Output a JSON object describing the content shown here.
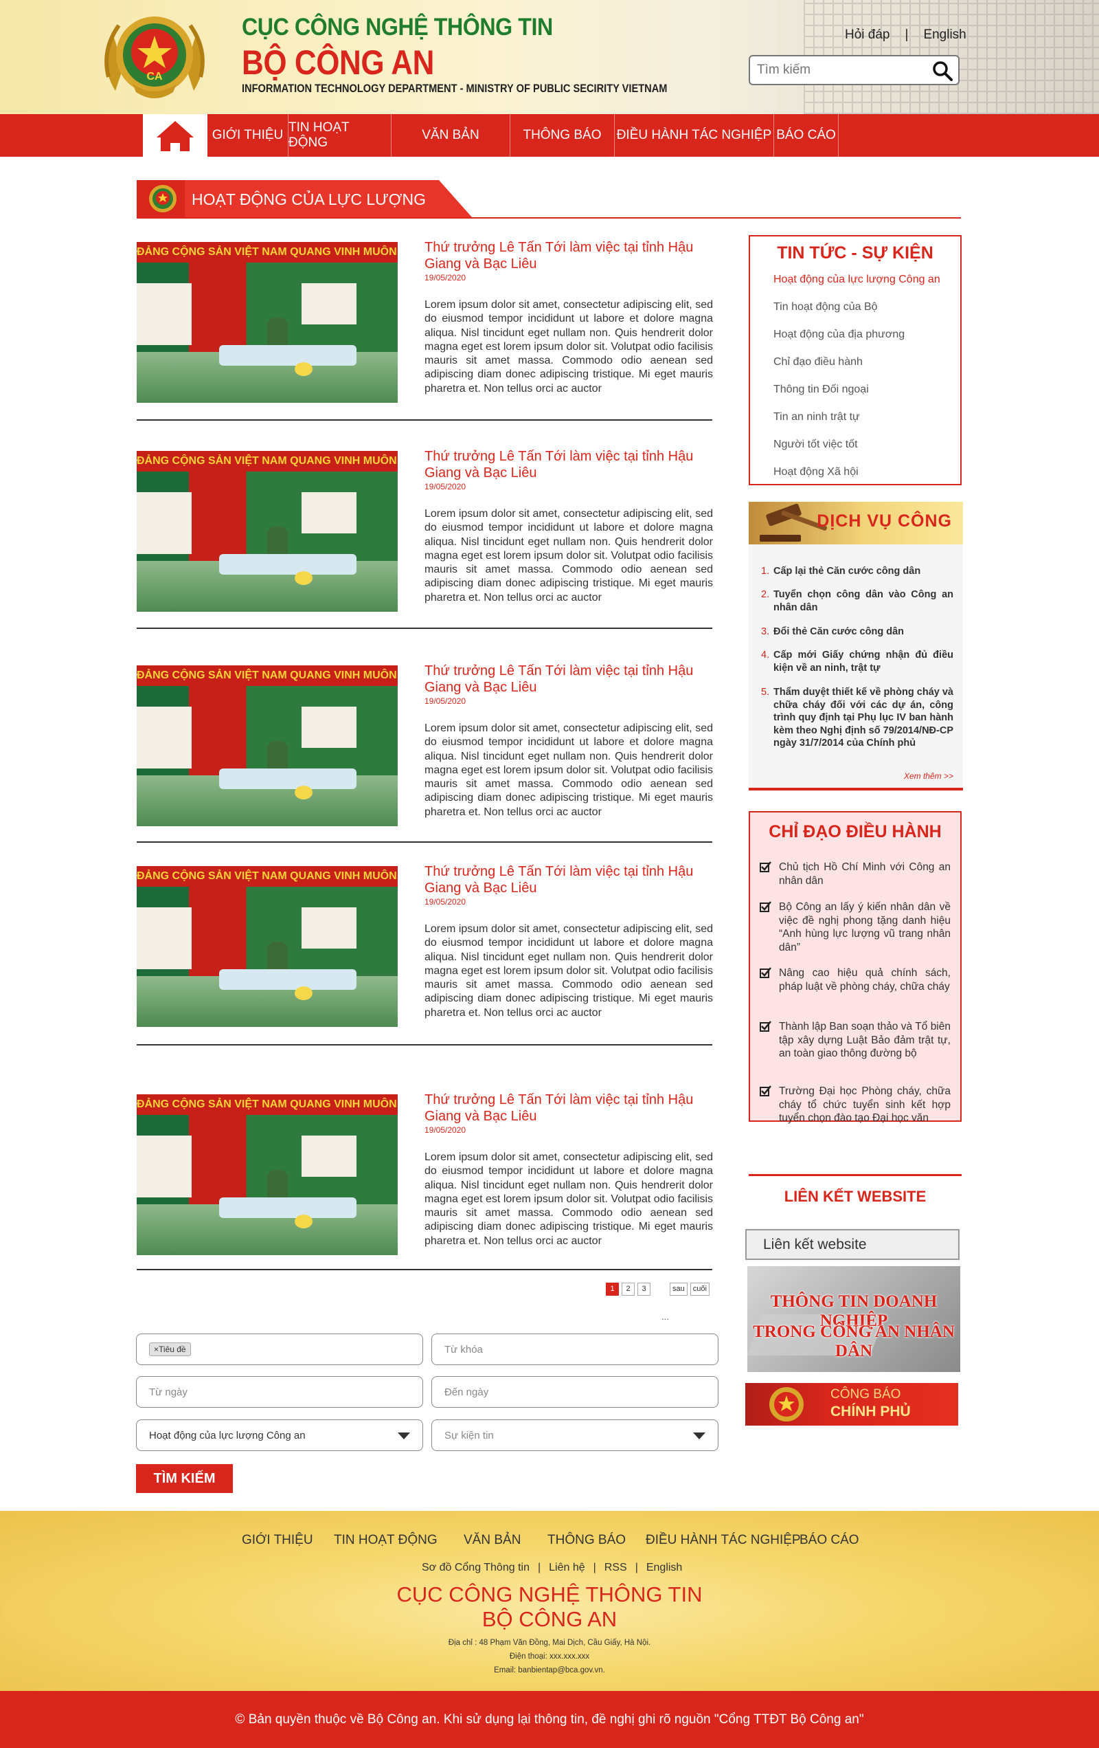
{
  "header": {
    "title_line1": "CỤC CÔNG NGHỆ THÔNG TIN",
    "title_line2": "BỘ CÔNG AN",
    "title_line3": "INFORMATION TECHNOLOGY DEPARTMENT - MINISTRY OF PUBLIC SECIRITY VIETNAM",
    "faq": "Hỏi đáp",
    "english": "English",
    "search_placeholder": "Tìm kiếm"
  },
  "nav": [
    "GIỚI THIỆU",
    "TIN HOẠT ĐỘNG",
    "VĂN BẢN",
    "THÔNG BÁO",
    "ĐIỀU HÀNH TÁC NGHIỆP",
    "BÁO CÁO"
  ],
  "section_title": "HOẠT ĐỘNG CỦA LỰC LƯỢNG",
  "image_banner": "ĐẢNG CỘNG SẢN VIỆT NAM QUANG VINH MUÔN NĂM",
  "articles": [
    {
      "title": "Thứ trưởng Lê Tấn Tới làm việc tại tỉnh Hậu Giang và Bạc Liêu",
      "date": "19/05/2020",
      "body": "Lorem ipsum dolor sit amet, consectetur adipiscing elit, sed do eiusmod tempor incididunt ut labore et dolore magna aliqua. Nisl tincidunt eget nullam non. Quis hendrerit dolor magna eget est lorem ipsum dolor sit. Volutpat odio facilisis mauris sit amet massa. Commodo odio aenean sed adipiscing diam donec adipiscing tristique. Mi eget mauris pharetra et. Non tellus orci ac auctor"
    },
    {
      "title": "Thứ trưởng Lê Tấn Tới làm việc tại tỉnh Hậu Giang và Bạc Liêu",
      "date": "19/05/2020",
      "body": "Lorem ipsum dolor sit amet, consectetur adipiscing elit, sed do eiusmod tempor incididunt ut labore et dolore magna aliqua. Nisl tincidunt eget nullam non. Quis hendrerit dolor magna eget est lorem ipsum dolor sit. Volutpat odio facilisis mauris sit amet massa. Commodo odio aenean sed adipiscing diam donec adipiscing tristique. Mi eget mauris pharetra et. Non tellus orci ac auctor"
    },
    {
      "title": "Thứ trưởng Lê Tấn Tới làm việc tại tỉnh Hậu Giang và Bạc Liêu",
      "date": "19/05/2020",
      "body": "Lorem ipsum dolor sit amet, consectetur adipiscing elit, sed do eiusmod tempor incididunt ut labore et dolore magna aliqua. Nisl tincidunt eget nullam non. Quis hendrerit dolor magna eget est lorem ipsum dolor sit. Volutpat odio facilisis mauris sit amet massa. Commodo odio aenean sed adipiscing diam donec adipiscing tristique. Mi eget mauris pharetra et. Non tellus orci ac auctor"
    },
    {
      "title": "Thứ trưởng Lê Tấn Tới làm việc tại tỉnh Hậu Giang và Bạc Liêu",
      "date": "19/05/2020",
      "body": "Lorem ipsum dolor sit amet, consectetur adipiscing elit, sed do eiusmod tempor incididunt ut labore et dolore magna aliqua. Nisl tincidunt eget nullam non. Quis hendrerit dolor magna eget est lorem ipsum dolor sit. Volutpat odio facilisis mauris sit amet massa. Commodo odio aenean sed adipiscing diam donec adipiscing tristique. Mi eget mauris pharetra et. Non tellus orci ac auctor"
    },
    {
      "title": "Thứ trưởng Lê Tấn Tới làm việc tại tỉnh Hậu Giang và Bạc Liêu",
      "date": "19/05/2020",
      "body": "Lorem ipsum dolor sit amet, consectetur adipiscing elit, sed do eiusmod tempor incididunt ut labore et dolore magna aliqua. Nisl tincidunt eget nullam non. Quis hendrerit dolor magna eget est lorem ipsum dolor sit. Volutpat odio facilisis mauris sit amet massa. Commodo odio aenean sed adipiscing diam donec adipiscing tristique. Mi eget mauris pharetra et. Non tellus orci ac auctor"
    }
  ],
  "pagination": {
    "pages": [
      "1",
      "2",
      "3"
    ],
    "active": "1",
    "next": "sau",
    "last": "cuối",
    "ellipsis": "..."
  },
  "search_form": {
    "tag": "Tiêu đề",
    "keyword_placeholder": "Từ khóa",
    "from_date_placeholder": "Từ ngày",
    "to_date_placeholder": "Đến ngày",
    "category_value": "Hoạt động của lực lượng Công an",
    "event_value": "Sự kiện tin",
    "button": "TÌM KIẾM"
  },
  "news_box": {
    "title": "TIN TỨC - SỰ KIỆN",
    "items": [
      "Hoạt động của lực lượng Công an",
      "Tin hoạt động của Bộ",
      "Hoạt động của địa phương",
      "Chỉ đạo điều hành",
      "Thông tin Đối ngoại",
      "Tin an ninh trật tự",
      "Người tốt việc tốt",
      "Hoạt động Xã hội"
    ]
  },
  "public_service": {
    "title": "DỊCH VỤ CÔNG",
    "items": [
      {
        "num": "1.",
        "text": "Cấp lại thẻ Căn cước công dân"
      },
      {
        "num": "2.",
        "text": "Tuyển chọn công dân vào Công an nhân dân"
      },
      {
        "num": "3.",
        "text": "Đổi thẻ Căn cước công dân"
      },
      {
        "num": "4.",
        "text": "Cấp mới Giấy chứng nhận đủ điều kiện về an ninh, trật tự"
      },
      {
        "num": "5.",
        "text": "Thẩm duyệt thiết kế về phòng cháy và chữa cháy đối với các dự án, công trình quy định tại Phụ lục IV ban hành kèm theo Nghị định số 79/2014/NĐ-CP ngày 31/7/2014 của Chính phủ"
      }
    ],
    "more": "Xem thêm >>"
  },
  "direction": {
    "title": "CHỈ ĐẠO ĐIỀU HÀNH",
    "items": [
      "Chủ tịch Hồ Chí Minh với Công an nhân dân",
      "Bộ Công an lấy ý kiến nhân dân về việc đề nghị phong tặng danh hiệu “Anh hùng lực lượng vũ trang nhân dân”",
      "Nâng cao hiệu quả chính sách, pháp luật về phòng cháy, chữa cháy",
      "Thành lập Ban soạn thảo và Tổ biên tập xây dựng Luật Bảo đảm trật tự, an toàn giao thông đường bộ",
      "Trường Đại học Phòng cháy, chữa cháy tổ chức tuyển sinh kết hợp tuyển chọn đào tạo Đại học văn"
    ]
  },
  "links": {
    "title": "LIÊN KẾT WEBSITE",
    "select_value": "Liên kết website",
    "banner1_line1": "THÔNG TIN DOANH NGHIỆP",
    "banner1_line2": "TRONG CÔNG AN NHÂN DÂN",
    "banner2_line1": "CÔNG BÁO",
    "banner2_line2": "CHÍNH PHỦ"
  },
  "footer": {
    "nav": [
      "GIỚI THIỆU",
      "TIN HOẠT ĐỘNG",
      "VĂN BẢN",
      "THÔNG BÁO",
      "ĐIỀU HÀNH TÁC NGHIỆP",
      "BÁO CÁO"
    ],
    "links": [
      "Sơ đồ Cổng Thông tin",
      "Liên hệ",
      "RSS",
      "English"
    ],
    "name1": "CỤC CÔNG NGHỆ THÔNG TIN",
    "name2": "BỘ CÔNG AN",
    "address": "Địa chỉ : 48 Phạm Văn Đồng, Mai Dịch, Cầu Giấy, Hà Nội.",
    "phone": "Điện thoại: xxx.xxx.xxx",
    "email": "Email: banbientap@bca.gov.vn.",
    "copyright": "© Bản quyền thuộc về Bộ Công an. Khi sử dụng lại thông tin, đề nghị ghi rõ nguồn \"Cổng TTĐT Bộ Công an\""
  },
  "colors": {
    "primary_red": "#d9261c",
    "green": "#1f7d2d",
    "gold": "#f5d76c"
  }
}
